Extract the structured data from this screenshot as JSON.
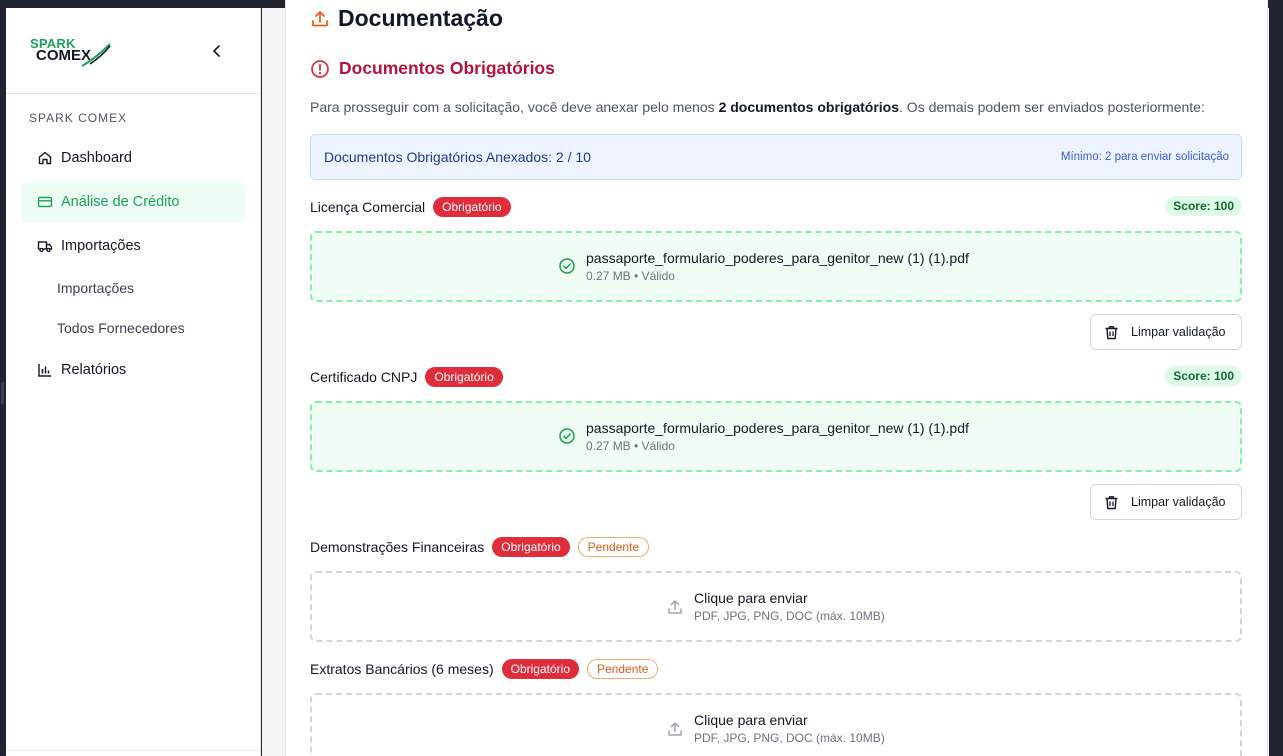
{
  "sidebar": {
    "logo_top": "SPARK",
    "logo_bottom": "COMEX",
    "section": "SPARK COMEX",
    "items": [
      {
        "label": "Dashboard",
        "icon": "home-icon"
      },
      {
        "label": "Análise de Crédito",
        "icon": "credit-card-icon",
        "active": true
      },
      {
        "label": "Importações",
        "icon": "truck-icon"
      },
      {
        "label": "Relatórios",
        "icon": "bar-chart-icon"
      }
    ],
    "subitems": [
      {
        "label": "Importações"
      },
      {
        "label": "Todos Fornecedores"
      }
    ]
  },
  "main": {
    "heading": "Documentação",
    "required_heading": "Documentos Obrigatórios",
    "intro_prefix": "Para prosseguir com a solicitação, você deve anexar pelo menos ",
    "intro_bold": "2 documentos obrigatórios",
    "intro_suffix": ". Os demais podem ser enviados posteriormente:",
    "counter_label": "Documentos Obrigatórios Anexados: 2 / 10",
    "counter_min": "Mínimo: 2 para enviar solicitação",
    "required_badge": "Obrigatório",
    "pending_badge": "Pendente",
    "clear_label": "Limpar validação",
    "upload_title": "Clique para enviar",
    "upload_hint": "PDF, JPG, PNG, DOC (máx. 10MB)",
    "documents": [
      {
        "name": "Licença Comercial",
        "score": "Score: 100",
        "file": "passaporte_formulario_poderes_para_genitor_new (1) (1).pdf",
        "meta": "0.27 MB • Válido"
      },
      {
        "name": "Certificado CNPJ",
        "score": "Score: 100",
        "file": "passaporte_formulario_poderes_para_genitor_new (1) (1).pdf",
        "meta": "0.27 MB • Válido"
      },
      {
        "name": "Demonstrações Financeiras"
      },
      {
        "name": "Extratos Bancários (6 meses)"
      }
    ]
  },
  "colors": {
    "brand_green": "#1ea05a",
    "required_red": "#e02d3c",
    "heading_red": "#b3123a",
    "pending_orange": "#dd5b17",
    "accent_orange": "#e8590c"
  }
}
